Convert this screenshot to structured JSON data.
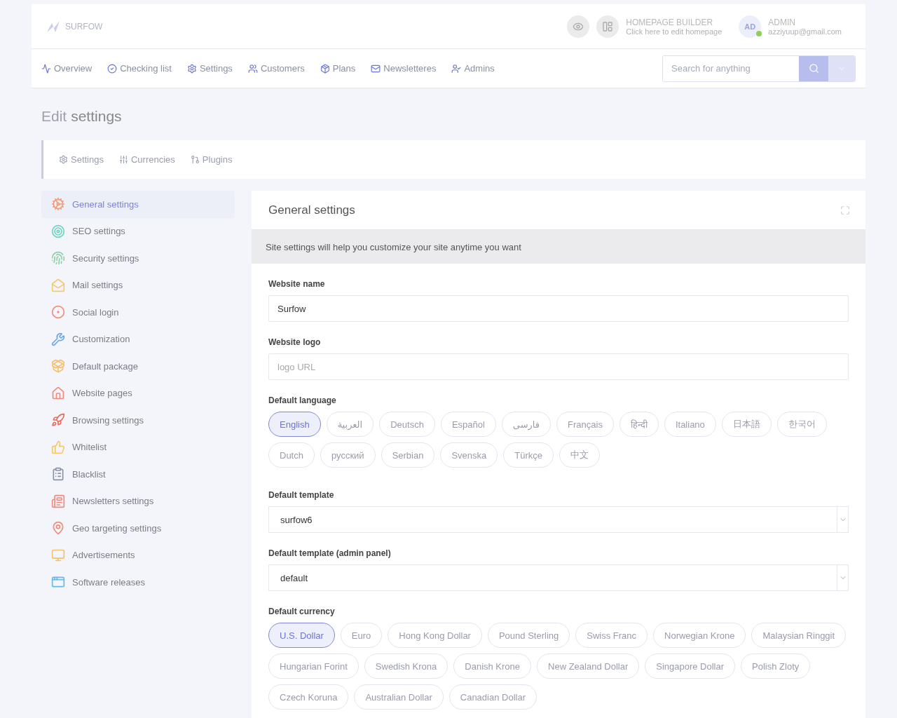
{
  "header": {
    "logo": "SURFOW",
    "builder": {
      "title": "HOMEPAGE BUILDER",
      "subtitle": "Click here to edit homepage"
    },
    "user": {
      "initials": "AD",
      "name": "ADMIN",
      "email": "azziyuup@gmail.com",
      "online": true
    }
  },
  "nav": [
    "Overview",
    "Checking list",
    "Settings",
    "Customers",
    "Plans",
    "Newsletteres",
    "Admins"
  ],
  "search": {
    "placeholder": "Search for anything"
  },
  "page_title": {
    "light": "Edit",
    "main": "settings"
  },
  "subtabs": [
    "Settings",
    "Currencies",
    "Plugins"
  ],
  "sidebar": [
    {
      "label": "General settings",
      "selected": true
    },
    {
      "label": "SEO settings",
      "selected": false
    },
    {
      "label": "Security settings",
      "selected": false
    },
    {
      "label": "Mail settings",
      "selected": false
    },
    {
      "label": "Social login",
      "selected": false
    },
    {
      "label": "Customization",
      "selected": false
    },
    {
      "label": "Default package",
      "selected": false
    },
    {
      "label": "Website pages",
      "selected": false
    },
    {
      "label": "Browsing settings",
      "selected": false
    },
    {
      "label": "Whitelist",
      "selected": false
    },
    {
      "label": "Blacklist",
      "selected": false
    },
    {
      "label": "Newsletters settings",
      "selected": false
    },
    {
      "label": "Geo targeting settings",
      "selected": false
    },
    {
      "label": "Advertisements",
      "selected": false
    },
    {
      "label": "Software releases",
      "selected": false
    }
  ],
  "panel": {
    "title": "General settings",
    "notice": "Site settings will help you customize your site anytime you want",
    "fields": [
      {
        "kind": "text",
        "label": "Website name",
        "value": "Surfow"
      },
      {
        "kind": "text",
        "label": "Website logo",
        "placeholder": "logo URL"
      },
      {
        "kind": "pills",
        "label": "Default language",
        "options": [
          {
            "label": "English",
            "selected": true
          },
          {
            "label": "العربية",
            "selected": false
          },
          {
            "label": "Deutsch",
            "selected": false
          },
          {
            "label": "Español",
            "selected": false
          },
          {
            "label": "فارسی",
            "selected": false
          },
          {
            "label": "Français",
            "selected": false
          },
          {
            "label": "हिन्दी",
            "selected": false
          },
          {
            "label": "Italiano",
            "selected": false
          },
          {
            "label": "日本語",
            "selected": false
          },
          {
            "label": "한국어",
            "selected": false
          },
          {
            "label": "Dutch",
            "selected": false
          },
          {
            "label": "русский",
            "selected": false
          },
          {
            "label": "Serbian",
            "selected": false
          },
          {
            "label": "Svenska",
            "selected": false
          },
          {
            "label": "Türkçe",
            "selected": false
          },
          {
            "label": "中文",
            "selected": false
          }
        ]
      },
      {
        "kind": "select",
        "label": "Default template",
        "value": "surfow6"
      },
      {
        "kind": "select",
        "label": "Default template (admin panel)",
        "value": "default"
      },
      {
        "kind": "pills",
        "label": "Default currency",
        "options": [
          {
            "label": "U.S. Dollar",
            "selected": true
          },
          {
            "label": "Euro",
            "selected": false
          },
          {
            "label": "Hong Kong Dollar",
            "selected": false
          },
          {
            "label": "Pound Sterling",
            "selected": false
          },
          {
            "label": "Swiss Franc",
            "selected": false
          },
          {
            "label": "Norwegian Krone",
            "selected": false
          },
          {
            "label": "Malaysian Ringgit",
            "selected": false
          },
          {
            "label": "Hungarian Forint",
            "selected": false
          },
          {
            "label": "Swedish Krona",
            "selected": false
          },
          {
            "label": "Danish Krone",
            "selected": false
          },
          {
            "label": "New Zealand Dollar",
            "selected": false
          },
          {
            "label": "Singapore Dollar",
            "selected": false
          },
          {
            "label": "Polish Zloty",
            "selected": false
          },
          {
            "label": "Czech Koruna",
            "selected": false
          },
          {
            "label": "Australian Dollar",
            "selected": false
          },
          {
            "label": "Canadian Dollar",
            "selected": false
          }
        ]
      }
    ]
  }
}
